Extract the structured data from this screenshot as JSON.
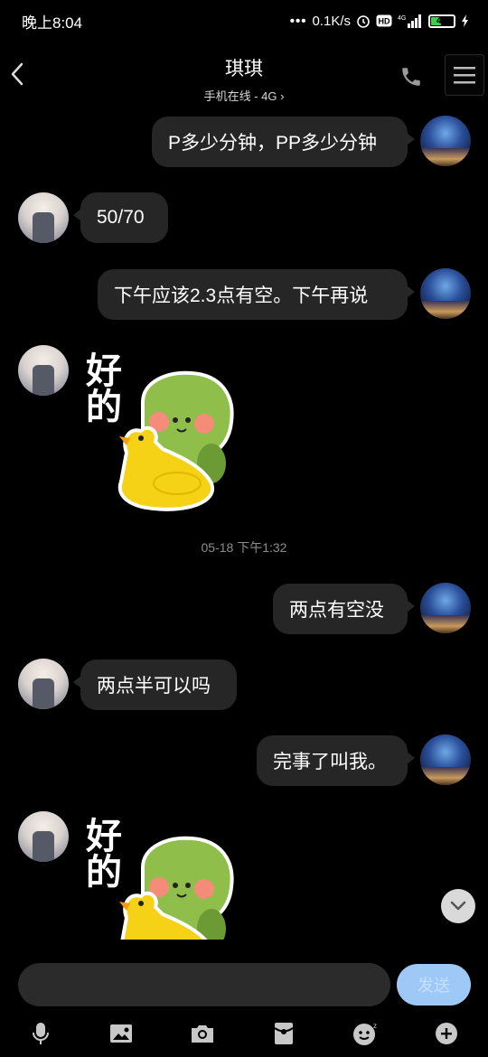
{
  "status_bar": {
    "time": "晚上8:04",
    "network_speed": "0.1K/s",
    "network_type": "4G",
    "battery_level": "44",
    "battery_fraction": 0.44,
    "icons": [
      "dots-icon",
      "alarm-icon",
      "hd-icon",
      "signal-icon",
      "battery-icon",
      "charging-icon"
    ]
  },
  "header": {
    "contact_name": "琪琪",
    "contact_status": "手机在线 - 4G",
    "icons": [
      "back-icon",
      "phone-icon",
      "menu-icon"
    ]
  },
  "messages": [
    {
      "sender": "me",
      "type": "text",
      "text": "P多少分钟，PP多少分钟"
    },
    {
      "sender": "other",
      "type": "text",
      "text": "50/70"
    },
    {
      "sender": "me",
      "type": "text",
      "text": "下午应该2.3点有空。下午再说"
    },
    {
      "sender": "other",
      "type": "sticker",
      "sticker_text": "好的",
      "sticker_icon": "turtle-sticker-icon"
    },
    {
      "type": "timestamp",
      "text": "05-18 下午1:32"
    },
    {
      "sender": "me",
      "type": "text",
      "text": "两点有空没"
    },
    {
      "sender": "other",
      "type": "text",
      "text": "两点半可以吗"
    },
    {
      "sender": "me",
      "type": "text",
      "text": "完事了叫我。"
    },
    {
      "sender": "other",
      "type": "sticker",
      "sticker_text": "好的",
      "sticker_icon": "turtle-sticker-icon"
    }
  ],
  "composer": {
    "input_value": "",
    "send_label": "发送",
    "toolbar_icons": [
      "microphone-icon",
      "image-icon",
      "camera-icon",
      "red-packet-icon",
      "emoji-icon",
      "plus-icon"
    ]
  },
  "colors": {
    "background": "#000000",
    "bubble": "#262626",
    "send_button": "#9ec9f7",
    "timestamp": "#8c8c8c"
  }
}
